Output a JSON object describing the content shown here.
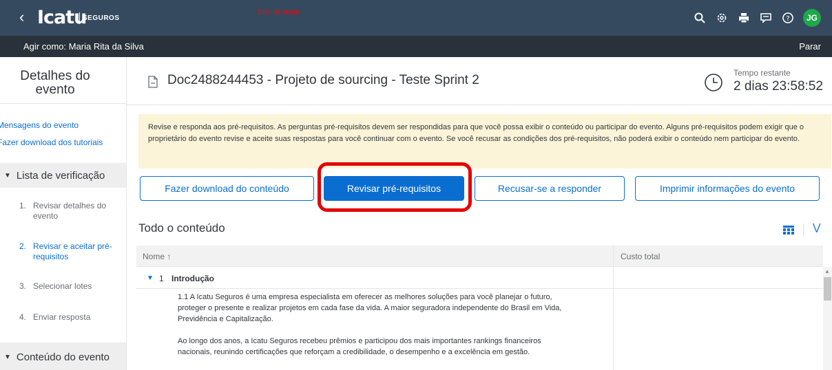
{
  "topbar": {
    "back_icon": "chevron-left-icon",
    "logo": "Icatu",
    "logo_sub": "SEGUROS",
    "site_test": "Site de teste",
    "icons": [
      "search-icon",
      "settings-icon",
      "print-icon",
      "feedback-icon",
      "help-icon"
    ],
    "avatar": "JG"
  },
  "action_bar": {
    "acting_as": "Agir como: Maria Rita da Silva",
    "stop": "Parar"
  },
  "sidebar": {
    "title_line1": "Detalhes do",
    "title_line2": "evento",
    "links": [
      "Mensagens do evento",
      "Fazer download dos tutoriais"
    ],
    "checklist_label": "Lista de verificação",
    "steps": [
      {
        "num": "1.",
        "label": "Revisar detalhes do evento"
      },
      {
        "num": "2.",
        "label": "Revisar e aceitar pré-requisitos"
      },
      {
        "num": "3.",
        "label": "Selecionar lotes"
      },
      {
        "num": "4.",
        "label": "Enviar resposta"
      }
    ],
    "content_label": "Conteúdo do evento"
  },
  "header": {
    "doc_title": "Doc2488244453 - Projeto de sourcing - Teste Sprint 2",
    "time_label": "Tempo restante",
    "time_value": "2 dias 23:58:52"
  },
  "info_message": "Revise e responda aos pré-requisitos. As perguntas pré-requisitos devem ser respondidas para que você possa exibir o conteúdo ou participar do evento. Alguns pré-requisitos podem exigir que o proprietário do evento revise e aceite suas respostas para você continuar com o evento. Se você recusar as condições dos pré-requisitos, não poderá exibir o conteúdo nem participar do evento.",
  "buttons": {
    "download": "Fazer download do conteúdo",
    "review": "Revisar pré-requisitos",
    "decline": "Recusar-se a responder",
    "print": "Imprimir informações do evento"
  },
  "content": {
    "title": "Todo o conteúdo",
    "columns": [
      "Nome ↑",
      "Custo total"
    ],
    "section_num": "1",
    "section_label": "Introdução",
    "item_text_1": "1.1  A Icatu Seguros é uma empresa especialista em oferecer as melhores soluções para você planejar o futuro, proteger o presente e realizar projetos em cada fase da vida. A maior seguradora independente do Brasil em Vida, Previdência e Capitalização.",
    "item_text_2": "Ao longo dos anos, a Icatu Seguros recebeu prêmios e participou dos mais importantes rankings financeiros nacionais, reunindo certificações que reforçam a credibilidade, o desempenho e a excelência em gestão."
  },
  "colors": {
    "shell": "#354a5f",
    "action_bar": "#29313a",
    "accent": "#0a6ed1",
    "info_bg": "#fcf4d8",
    "highlight": "#e30000"
  }
}
